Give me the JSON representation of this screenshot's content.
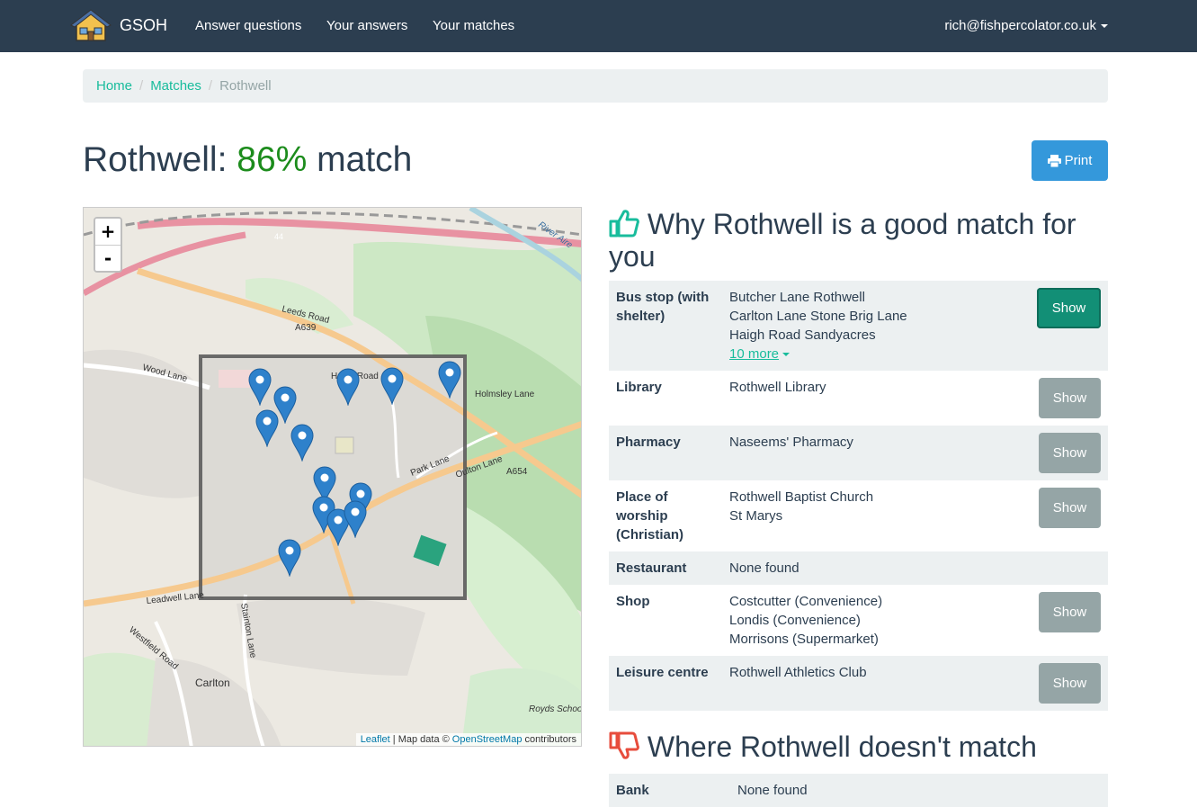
{
  "navbar": {
    "brand": "GSOH",
    "links": [
      "Answer questions",
      "Your answers",
      "Your matches"
    ],
    "user_email": "rich@fishpercolator.co.uk"
  },
  "breadcrumb": {
    "home": "Home",
    "matches": "Matches",
    "current": "Rothwell"
  },
  "page": {
    "title_prefix": "Rothwell:",
    "match_percent": "86%",
    "title_suffix": "match",
    "print_label": "Print"
  },
  "map": {
    "zoom_in": "+",
    "zoom_out": "-",
    "attribution_leaflet": "Leaflet",
    "attribution_mid": "| Map data ©",
    "attribution_osm": "OpenStreetMap",
    "attribution_end": "contributors",
    "road_labels": [
      "Leeds Road",
      "A639",
      "Wood Lane",
      "Haigh Road",
      "Holmsley Lane",
      "Park Lane",
      "Oulton Lane",
      "A654",
      "Leadwell Lane",
      "Westfield Road",
      "Stainton Lane",
      "Carlton",
      "Royds School",
      "44",
      "River Aire"
    ]
  },
  "good_match": {
    "title": "Why Rothwell is a good match for you",
    "rows": [
      {
        "category": "Bus stop (with shelter)",
        "items": [
          "Butcher Lane Rothwell",
          "Carlton Lane Stone Brig Lane",
          "Haigh Road Sandyacres"
        ],
        "more": "10 more",
        "button": "Show"
      },
      {
        "category": "Library",
        "items": [
          "Rothwell Library"
        ],
        "button": "Show"
      },
      {
        "category": "Pharmacy",
        "items": [
          "Naseems' Pharmacy"
        ],
        "button": "Show"
      },
      {
        "category": "Place of worship (Christian)",
        "items": [
          "Rothwell Baptist Church",
          "St Marys"
        ],
        "button": "Show"
      },
      {
        "category": "Restaurant",
        "items": [
          "None found"
        ]
      },
      {
        "category": "Shop",
        "items": [
          "Costcutter (Convenience)",
          "Londis (Convenience)",
          "Morrisons (Supermarket)"
        ],
        "button": "Show"
      },
      {
        "category": "Leisure centre",
        "items": [
          "Rothwell Athletics Club"
        ],
        "button": "Show"
      }
    ]
  },
  "bad_match": {
    "title": "Where Rothwell doesn't match",
    "rows": [
      {
        "category": "Bank",
        "items": [
          "None found"
        ]
      }
    ]
  },
  "colors": {
    "navbar": "#2c3e50",
    "accent": "#18bc9c",
    "good": "#18bc9c",
    "bad": "#e74c3c",
    "print_button": "#3498db",
    "show_button": "#95a5a6"
  }
}
